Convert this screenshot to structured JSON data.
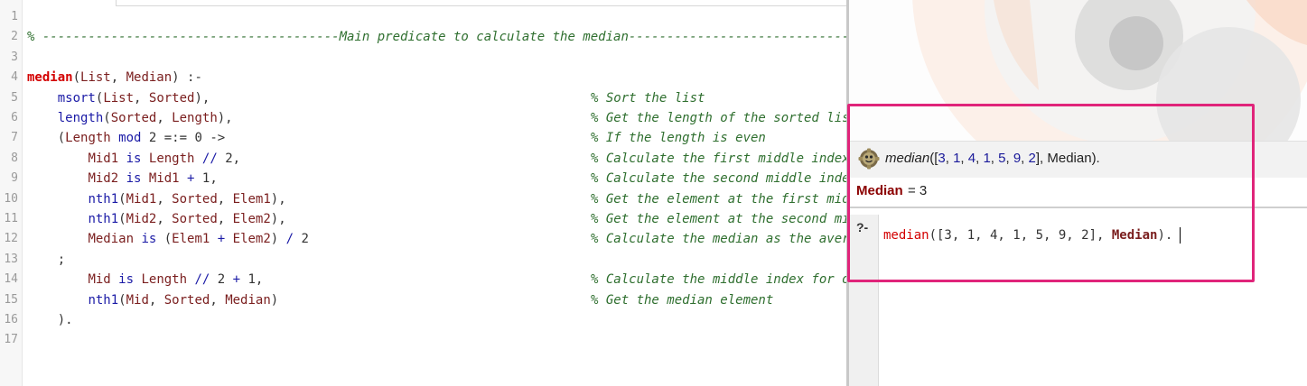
{
  "editor": {
    "lines": [
      {
        "n": "1",
        "code": [],
        "comment": ""
      },
      {
        "n": "2",
        "code": [
          [
            "c-comment",
            "% ---------------------------------------Main predicate to calculate the median--------------------------------------"
          ]
        ],
        "comment": ""
      },
      {
        "n": "3",
        "code": [],
        "comment": ""
      },
      {
        "n": "4",
        "code": [
          [
            "c-head",
            "median"
          ],
          [
            "c-txt",
            "("
          ],
          [
            "c-var",
            "List"
          ],
          [
            "c-txt",
            ", "
          ],
          [
            "c-var",
            "Median"
          ],
          [
            "c-txt",
            ") :-"
          ]
        ],
        "comment": ""
      },
      {
        "n": "5",
        "code": [
          [
            "c-txt",
            "    "
          ],
          [
            "c-pred",
            "msort"
          ],
          [
            "c-txt",
            "("
          ],
          [
            "c-var",
            "List"
          ],
          [
            "c-txt",
            ", "
          ],
          [
            "c-var",
            "Sorted"
          ],
          [
            "c-txt",
            "),"
          ]
        ],
        "comment": "% Sort the list"
      },
      {
        "n": "6",
        "code": [
          [
            "c-txt",
            "    "
          ],
          [
            "c-pred",
            "length"
          ],
          [
            "c-txt",
            "("
          ],
          [
            "c-var",
            "Sorted"
          ],
          [
            "c-txt",
            ", "
          ],
          [
            "c-var",
            "Length"
          ],
          [
            "c-txt",
            "),"
          ]
        ],
        "comment": "% Get the length of the sorted list"
      },
      {
        "n": "7",
        "code": [
          [
            "c-txt",
            "    ("
          ],
          [
            "c-var",
            "Length"
          ],
          [
            "c-txt",
            " "
          ],
          [
            "c-op",
            "mod"
          ],
          [
            "c-txt",
            " 2 =:= 0 ->"
          ]
        ],
        "comment": "% If the length is even"
      },
      {
        "n": "8",
        "code": [
          [
            "c-txt",
            "        "
          ],
          [
            "c-var",
            "Mid1"
          ],
          [
            "c-txt",
            " "
          ],
          [
            "c-op",
            "is"
          ],
          [
            "c-txt",
            " "
          ],
          [
            "c-var",
            "Length"
          ],
          [
            "c-txt",
            " "
          ],
          [
            "c-op",
            "//"
          ],
          [
            "c-txt",
            " 2,"
          ]
        ],
        "comment": "% Calculate the first middle index"
      },
      {
        "n": "9",
        "code": [
          [
            "c-txt",
            "        "
          ],
          [
            "c-var",
            "Mid2"
          ],
          [
            "c-txt",
            " "
          ],
          [
            "c-op",
            "is"
          ],
          [
            "c-txt",
            " "
          ],
          [
            "c-var",
            "Mid1"
          ],
          [
            "c-txt",
            " "
          ],
          [
            "c-op",
            "+"
          ],
          [
            "c-txt",
            " 1,"
          ]
        ],
        "comment": "% Calculate the second middle index"
      },
      {
        "n": "10",
        "code": [
          [
            "c-txt",
            "        "
          ],
          [
            "c-pred",
            "nth1"
          ],
          [
            "c-txt",
            "("
          ],
          [
            "c-var",
            "Mid1"
          ],
          [
            "c-txt",
            ", "
          ],
          [
            "c-var",
            "Sorted"
          ],
          [
            "c-txt",
            ", "
          ],
          [
            "c-var",
            "Elem1"
          ],
          [
            "c-txt",
            "),"
          ]
        ],
        "comment": "% Get the element at the first middle"
      },
      {
        "n": "11",
        "code": [
          [
            "c-txt",
            "        "
          ],
          [
            "c-pred",
            "nth1"
          ],
          [
            "c-txt",
            "("
          ],
          [
            "c-var",
            "Mid2"
          ],
          [
            "c-txt",
            ", "
          ],
          [
            "c-var",
            "Sorted"
          ],
          [
            "c-txt",
            ", "
          ],
          [
            "c-var",
            "Elem2"
          ],
          [
            "c-txt",
            "),"
          ]
        ],
        "comment": "% Get the element at the second middle"
      },
      {
        "n": "12",
        "code": [
          [
            "c-txt",
            "        "
          ],
          [
            "c-var",
            "Median"
          ],
          [
            "c-txt",
            " "
          ],
          [
            "c-op",
            "is"
          ],
          [
            "c-txt",
            " ("
          ],
          [
            "c-var",
            "Elem1"
          ],
          [
            "c-txt",
            " "
          ],
          [
            "c-op",
            "+"
          ],
          [
            "c-txt",
            " "
          ],
          [
            "c-var",
            "Elem2"
          ],
          [
            "c-txt",
            ") "
          ],
          [
            "c-op",
            "/"
          ],
          [
            "c-txt",
            " 2"
          ]
        ],
        "comment": "% Calculate the median as the average"
      },
      {
        "n": "13",
        "code": [
          [
            "c-txt",
            "    ;"
          ]
        ],
        "comment": ""
      },
      {
        "n": "14",
        "code": [
          [
            "c-txt",
            "        "
          ],
          [
            "c-var",
            "Mid"
          ],
          [
            "c-txt",
            " "
          ],
          [
            "c-op",
            "is"
          ],
          [
            "c-txt",
            " "
          ],
          [
            "c-var",
            "Length"
          ],
          [
            "c-txt",
            " "
          ],
          [
            "c-op",
            "//"
          ],
          [
            "c-txt",
            " 2 "
          ],
          [
            "c-op",
            "+"
          ],
          [
            "c-txt",
            " 1,"
          ]
        ],
        "comment": "% Calculate the middle index for odd"
      },
      {
        "n": "15",
        "code": [
          [
            "c-txt",
            "        "
          ],
          [
            "c-pred",
            "nth1"
          ],
          [
            "c-txt",
            "("
          ],
          [
            "c-var",
            "Mid"
          ],
          [
            "c-txt",
            ", "
          ],
          [
            "c-var",
            "Sorted"
          ],
          [
            "c-txt",
            ", "
          ],
          [
            "c-var",
            "Median"
          ],
          [
            "c-txt",
            ")"
          ]
        ],
        "comment": "% Get the median element"
      },
      {
        "n": "16",
        "code": [
          [
            "c-txt",
            "    )."
          ]
        ],
        "comment": ""
      },
      {
        "n": "17",
        "code": [],
        "comment": ""
      }
    ]
  },
  "query": {
    "icon": "gear-icon",
    "predicate": "median",
    "open": "([",
    "numbers": [
      "3",
      "1",
      "4",
      "1",
      "5",
      "9",
      "2"
    ],
    "close": "], ",
    "variable": "Median",
    "end": ")."
  },
  "answer": {
    "variable": "Median",
    "equals": " = 3"
  },
  "prompt": {
    "symbol": "?-",
    "head": "median",
    "args": "([3, 1, 4, 1, 5, 9, 2], ",
    "variable": "Median",
    "end": ")."
  },
  "colors": {
    "highlight": "#e0247a",
    "comment": "#2f6f2f",
    "head": "#d30000",
    "variable": "#7a1e1e",
    "builtin": "#1a1aa6"
  }
}
